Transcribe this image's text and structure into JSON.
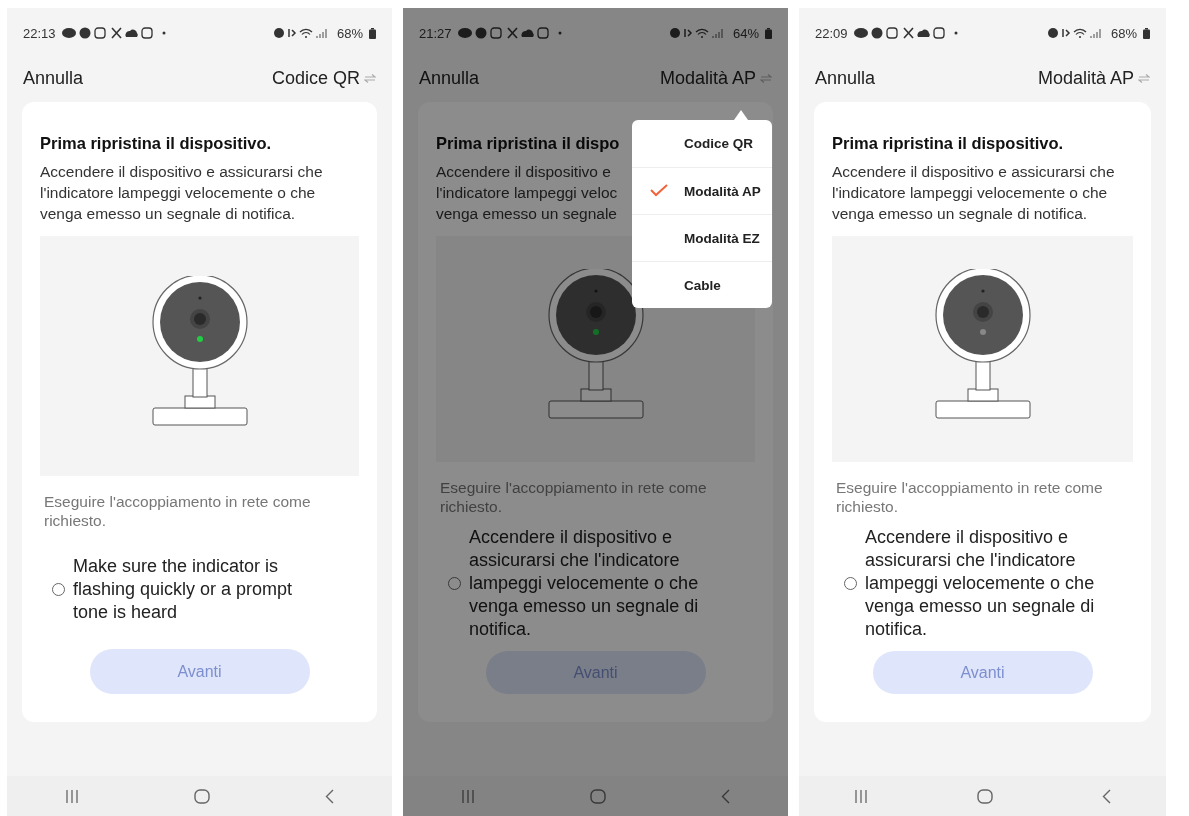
{
  "screens": [
    {
      "status_bar": {
        "time": "22:13",
        "battery": "68%"
      },
      "nav": {
        "cancel": "Annulla",
        "mode": "Codice QR"
      },
      "card": {
        "title": "Prima ripristina il dispositivo.",
        "description": "Accendere il dispositivo e assicurarsi che l'indicatore lampeggi velocemente o che venga emesso un segnale di notifica.",
        "led_on": true,
        "hint": "Eseguire l'accoppiamento in rete come richiesto.",
        "confirm": {
          "label": "Make sure the indicator is flashing quickly or a prompt tone is heard",
          "checked": false
        },
        "next_button": {
          "label": "Avanti",
          "disabled": true
        }
      }
    },
    {
      "status_bar": {
        "time": "21:27",
        "battery": "64%"
      },
      "nav": {
        "cancel": "Annulla",
        "mode": "Modalità AP"
      },
      "card": {
        "title": "Prima ripristina il dispo",
        "description": "Accendere il dispositivo e\nl'indicatore lampeggi veloc\nvenga emesso un segnale",
        "led_on": true,
        "hint": "Eseguire l'accoppiamento in rete come richiesto.",
        "confirm": {
          "label": "Accendere il dispositivo e assicurarsi che l'indicatore lampeggi velocemente o che venga emesso un segnale di notifica.",
          "checked": false
        },
        "next_button": {
          "label": "Avanti",
          "disabled": true
        }
      },
      "menu": {
        "items": [
          {
            "label": "Codice QR",
            "selected": false
          },
          {
            "label": "Modalità AP",
            "selected": true
          },
          {
            "label": "Modalità EZ",
            "selected": false
          },
          {
            "label": "Cable",
            "selected": false
          }
        ]
      }
    },
    {
      "status_bar": {
        "time": "22:09",
        "battery": "68%"
      },
      "nav": {
        "cancel": "Annulla",
        "mode": "Modalità AP"
      },
      "card": {
        "title": "Prima ripristina il dispositivo.",
        "description": "Accendere il dispositivo e assicurarsi che l'indicatore lampeggi velocemente o che venga emesso un segnale di notifica.",
        "led_on": false,
        "hint": "Eseguire l'accoppiamento in rete come richiesto.",
        "confirm": {
          "label": "Accendere il dispositivo e assicurarsi che l'indicatore lampeggi velocemente o che venga emesso un segnale di notifica.",
          "checked": false
        },
        "next_button": {
          "label": "Avanti",
          "disabled": true
        }
      }
    }
  ]
}
